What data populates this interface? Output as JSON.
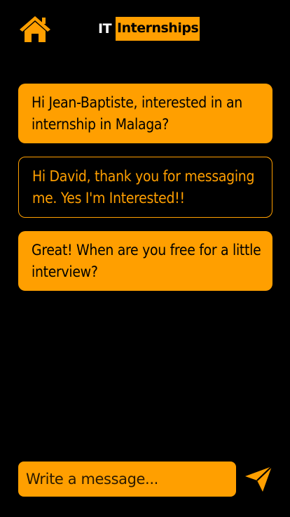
{
  "header": {
    "home_icon": "home-icon",
    "brand_prefix": "IT",
    "brand_word": "Internships"
  },
  "messages": [
    {
      "sender": "them",
      "text": "Hi Jean-Baptiste, interested in an internship in Malaga?"
    },
    {
      "sender": "me",
      "text": "Hi David, thank you for messaging me. Yes I'm Interested!!"
    },
    {
      "sender": "them",
      "text": "Great! When are you free for a little interview?"
    }
  ],
  "composer": {
    "placeholder": "Write a message...",
    "value": "",
    "send_icon": "send-icon"
  },
  "colors": {
    "accent": "#ff9f00",
    "background": "#000000",
    "text_on_accent": "#000000",
    "brand_prefix": "#ffffff"
  }
}
